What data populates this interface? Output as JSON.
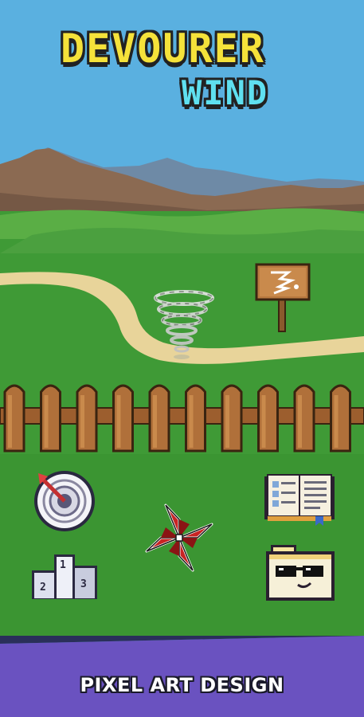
{
  "title": {
    "line1": "DEVOURER",
    "line2": "WIND"
  },
  "sign": {
    "icon": "tornado-sign-icon"
  },
  "buttons": [
    {
      "id": "target",
      "icon": "target-icon"
    },
    {
      "id": "book",
      "icon": "book-icon"
    },
    {
      "id": "pinwheel",
      "icon": "pinwheel-icon"
    },
    {
      "id": "leaderboard",
      "icon": "podium-icon",
      "ranks": [
        "1",
        "2",
        "3"
      ]
    },
    {
      "id": "skins",
      "icon": "sunglasses-character-icon"
    }
  ],
  "banner": {
    "text": "PIXEL ART DESIGN"
  },
  "colors": {
    "sky": "#5ab0e0",
    "grass": "#3f9a36",
    "path": "#e8d49a",
    "fence": "#b0703a",
    "banner": "#6a52c0",
    "title_yellow": "#f5e23a",
    "title_cyan": "#5fe0f0"
  }
}
